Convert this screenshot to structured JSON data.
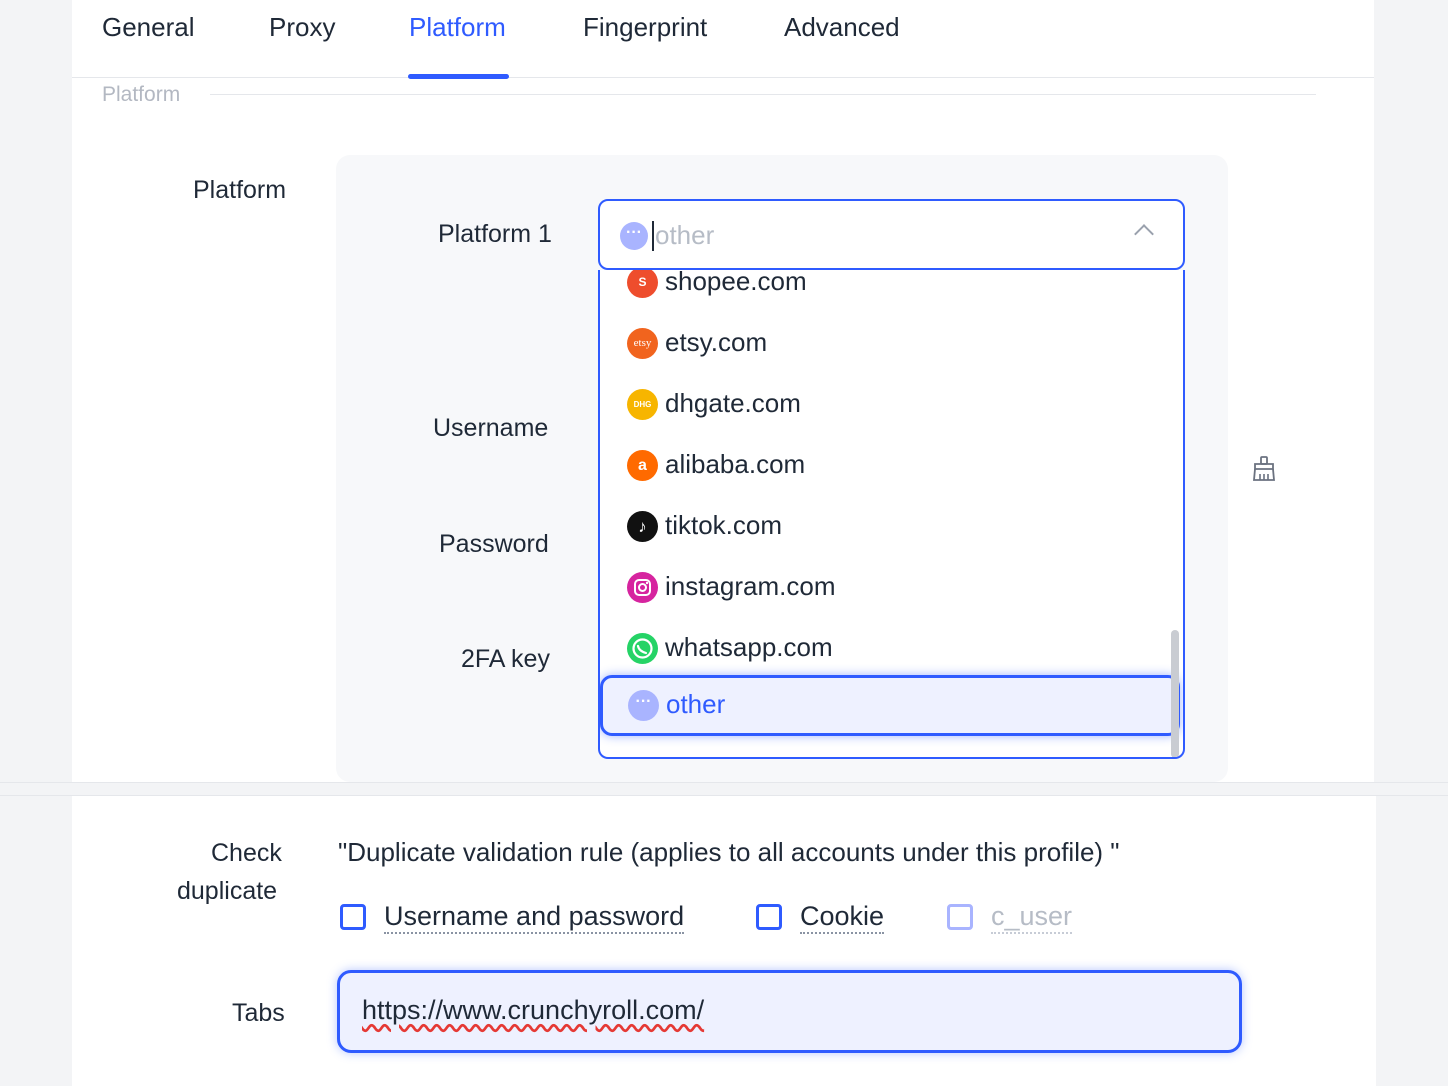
{
  "tabs": [
    {
      "label": "General"
    },
    {
      "label": "Proxy"
    },
    {
      "label": "Platform"
    },
    {
      "label": "Fingerprint"
    },
    {
      "label": "Advanced"
    }
  ],
  "active_tab": "Platform",
  "section_title": "Platform",
  "form": {
    "platform_label": "Platform",
    "platform1_label": "Platform 1",
    "username_label": "Username",
    "password_label": "Password",
    "twofa_label": "2FA key"
  },
  "platform_select": {
    "placeholder": "other",
    "icon": "more-dots-icon"
  },
  "dropdown": {
    "items": [
      {
        "label": "shopee.com",
        "icon": "shopee-icon",
        "color": "#ee4d2d"
      },
      {
        "label": "etsy.com",
        "icon": "etsy-icon",
        "color": "#f1641e"
      },
      {
        "label": "dhgate.com",
        "icon": "dhgate-icon",
        "color": "#f7b500"
      },
      {
        "label": "alibaba.com",
        "icon": "alibaba-icon",
        "color": "#ff6a00"
      },
      {
        "label": "tiktok.com",
        "icon": "tiktok-icon",
        "color": "#111111"
      },
      {
        "label": "instagram.com",
        "icon": "instagram-icon",
        "color": "#d6249f"
      },
      {
        "label": "whatsapp.com",
        "icon": "whatsapp-icon",
        "color": "#25d366"
      },
      {
        "label": "other",
        "icon": "more-dots-icon",
        "color": "#a9b4ff",
        "selected": true
      }
    ]
  },
  "check_duplicate": {
    "label_line1": "Check",
    "label_line2": "duplicate",
    "rule_text": "\"Duplicate validation rule (applies to all accounts under this profile) \"",
    "options": [
      {
        "label": "Username and password",
        "checked": false,
        "disabled": false
      },
      {
        "label": "Cookie",
        "checked": false,
        "disabled": false
      },
      {
        "label": "c_user",
        "checked": false,
        "disabled": true
      }
    ]
  },
  "tabs_field": {
    "label": "Tabs",
    "value": "https://www.crunchyroll.com/"
  },
  "colors": {
    "accent": "#2f5bff",
    "text": "#1f2937",
    "muted": "#b6bcc6"
  }
}
